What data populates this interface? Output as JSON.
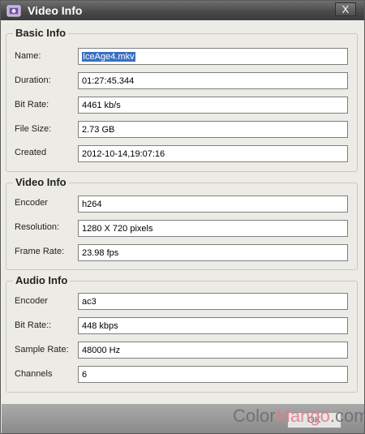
{
  "window": {
    "title": "Video Info",
    "close_label": "X"
  },
  "basic": {
    "title": "Basic Info",
    "name_label": "Name:",
    "name_value": "IceAge4.mkv",
    "duration_label": "Duration:",
    "duration_value": "01:27:45.344",
    "bitrate_label": "Bit Rate:",
    "bitrate_value": "4461 kb/s",
    "filesize_label": "File Size:",
    "filesize_value": "2.73 GB",
    "created_label": "Created",
    "created_value": "2012-10-14,19:07:16"
  },
  "video": {
    "title": "Video Info",
    "encoder_label": "Encoder",
    "encoder_value": "h264",
    "resolution_label": "Resolution:",
    "resolution_value": "1280 X 720 pixels",
    "framerate_label": "Frame Rate:",
    "framerate_value": "23.98 fps"
  },
  "audio": {
    "title": "Audio Info",
    "encoder_label": "Encoder",
    "encoder_value": "ac3",
    "bitrate_label": "Bit Rate::",
    "bitrate_value": "448 kbps",
    "samplerate_label": "Sample Rate:",
    "samplerate_value": "48000 Hz",
    "channels_label": "Channels",
    "channels_value": "6"
  },
  "footer": {
    "ok_label": "OK",
    "watermark_part1": "Color",
    "watermark_part2": "Mango",
    "watermark_part3": ".com"
  }
}
